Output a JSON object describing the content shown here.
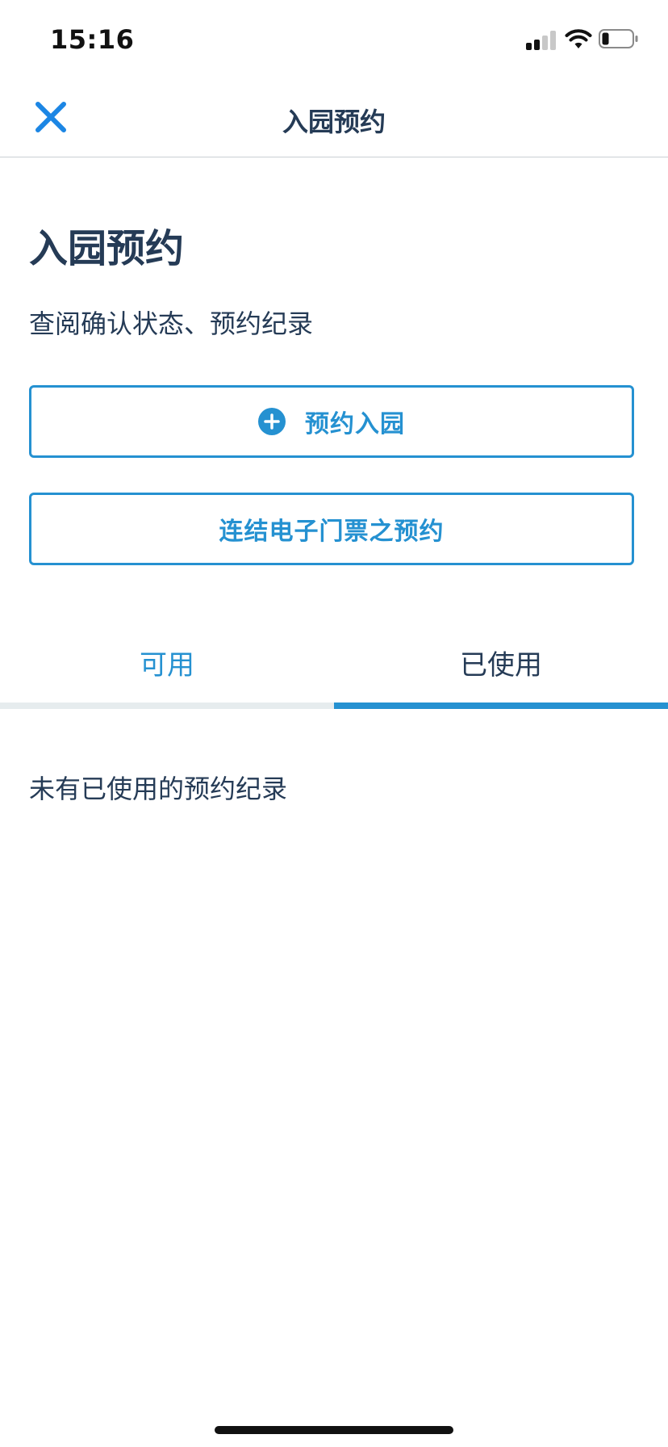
{
  "status_bar": {
    "time": "15:16",
    "icons": [
      "cellular-signal-icon",
      "wifi-icon",
      "battery-icon"
    ]
  },
  "nav": {
    "title": "入园预约",
    "close_icon": "close-icon"
  },
  "header": {
    "title": "入园预约",
    "subtitle": "查阅确认状态、预约纪录"
  },
  "actions": {
    "reserve_label": "预约入园",
    "reserve_icon": "plus-circle-icon",
    "link_ticket_label": "连结电子门票之预约"
  },
  "tabs": [
    {
      "label": "可用",
      "selected": false
    },
    {
      "label": "已使用",
      "selected": true
    }
  ],
  "empty_state": {
    "message": "未有已使用的预约纪录"
  },
  "colors": {
    "accent": "#2591d1",
    "text": "#253b56",
    "tab_track": "#e6ecee",
    "close_icon": "#1c86e4"
  }
}
